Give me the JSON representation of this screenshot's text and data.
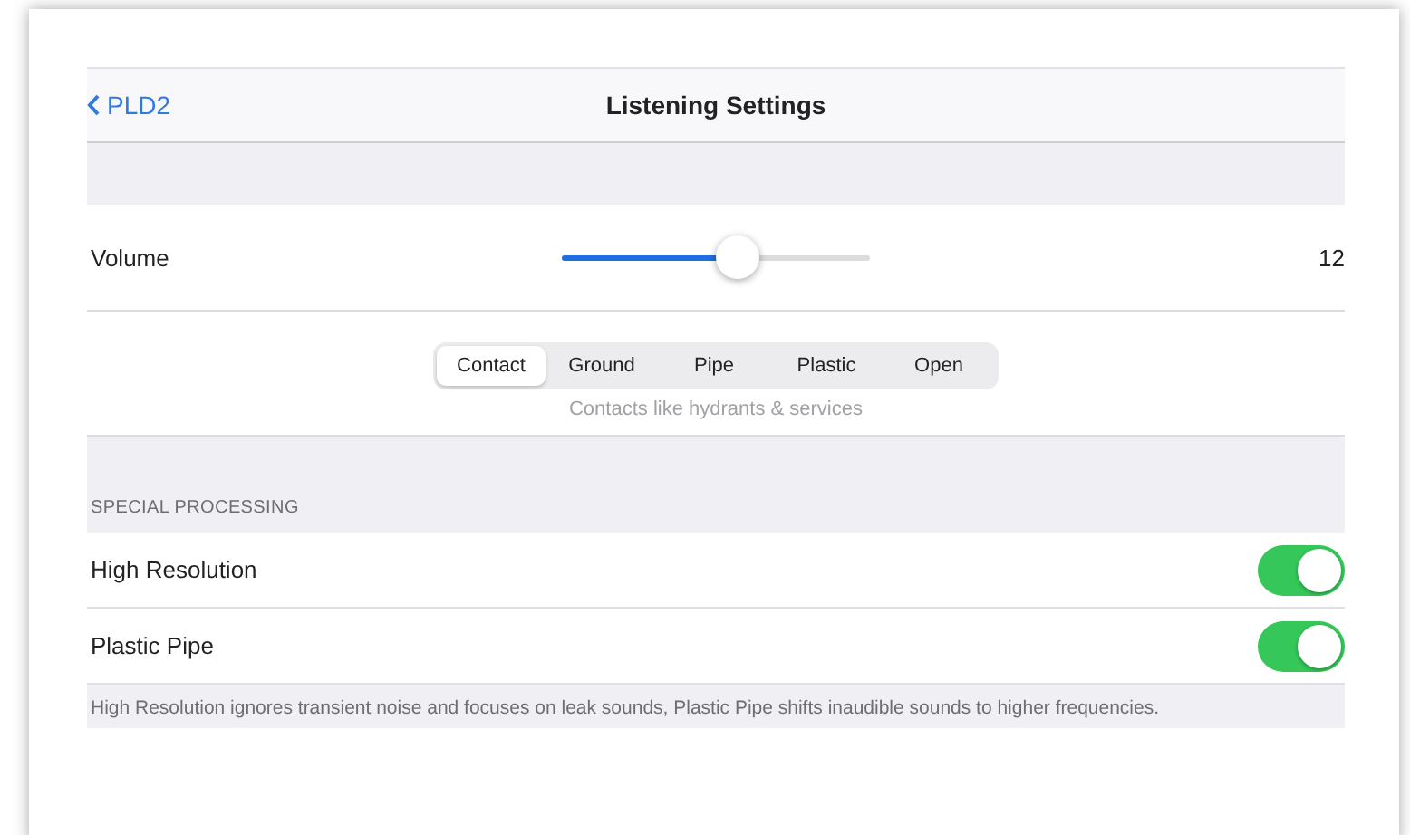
{
  "nav": {
    "back": "PLD2",
    "title": "Listening Settings"
  },
  "volume": {
    "label": "Volume",
    "level": 0.57,
    "reading": "12"
  },
  "segments": [
    {
      "label": "Contact",
      "selected": true
    },
    {
      "label": "Ground",
      "selected": false
    },
    {
      "label": "Pipe",
      "selected": false
    },
    {
      "label": "Plastic",
      "selected": false
    },
    {
      "label": "Open",
      "selected": false
    }
  ],
  "segment_hint": "Contacts like hydrants & services",
  "section": {
    "header": "SPECIAL PROCESSING",
    "rows": [
      {
        "label": "High Resolution",
        "on": true
      },
      {
        "label": "Plastic Pipe",
        "on": true
      }
    ],
    "footer": "High Resolution ignores transient noise and focuses on leak sounds, Plastic Pipe shifts inaudible sounds to higher frequencies."
  }
}
